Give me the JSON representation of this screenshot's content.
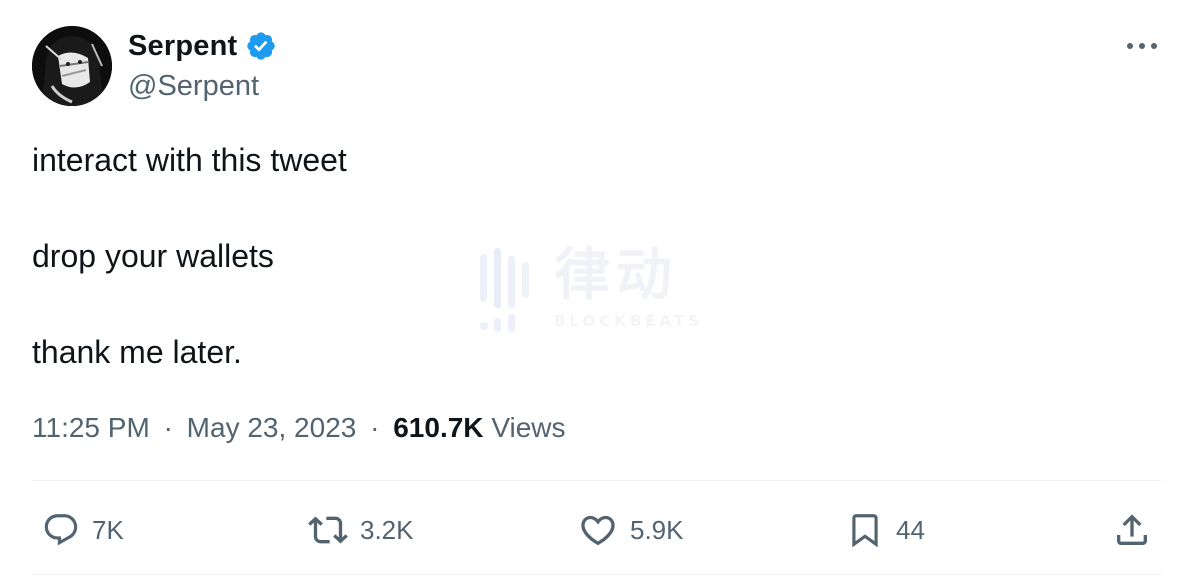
{
  "author": {
    "display_name": "Serpent",
    "handle": "@Serpent",
    "verified": true,
    "verified_color": "#1d9bf0"
  },
  "tweet": {
    "lines": [
      "interact with this tweet",
      "drop your wallets",
      "thank me later."
    ]
  },
  "meta": {
    "time": "11:25 PM",
    "separator": "·",
    "date": "May 23, 2023",
    "views_count": "610.7K",
    "views_label": "Views"
  },
  "watermark": {
    "chinese": "律动",
    "english": "BLOCKBEATS"
  },
  "actions": {
    "reply_count": "7K",
    "retweet_count": "3.2K",
    "like_count": "5.9K",
    "bookmark_count": "44"
  },
  "icons": {
    "more": "more-horizontal-icon",
    "reply": "reply-bubble-icon",
    "retweet": "retweet-arrows-icon",
    "like": "heart-icon",
    "bookmark": "bookmark-icon",
    "share": "share-upload-icon"
  }
}
